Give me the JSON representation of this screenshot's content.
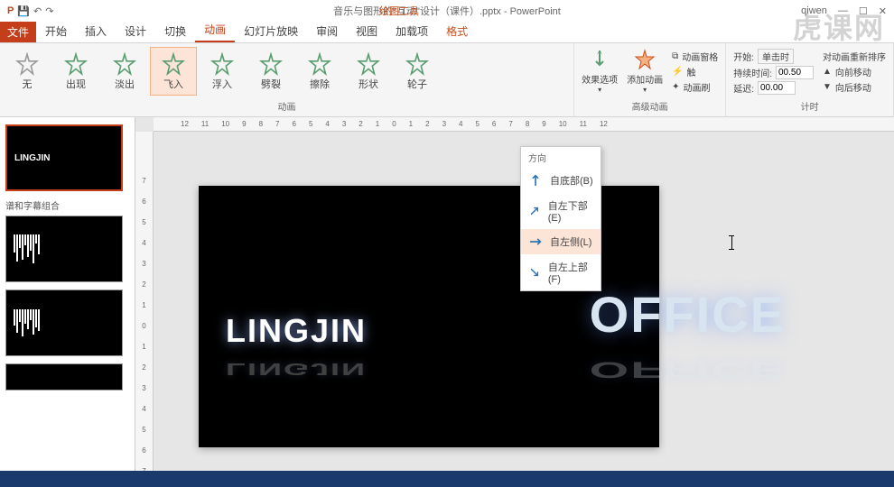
{
  "titlebar": {
    "title": "音乐与图形的\"互动\"设计（课件）.pptx - PowerPoint",
    "contextual": "绘图工具",
    "user": "qiwen"
  },
  "tabs": {
    "file": "文件",
    "items": [
      "开始",
      "插入",
      "设计",
      "切换",
      "动画",
      "幻灯片放映",
      "审阅",
      "视图",
      "加载项",
      "格式"
    ],
    "active_index": 4,
    "contextual_index": 9
  },
  "ribbon": {
    "animations": {
      "items": [
        {
          "label": "无",
          "color": "#999"
        },
        {
          "label": "出现",
          "color": "#5a9e6f"
        },
        {
          "label": "淡出",
          "color": "#5a9e6f"
        },
        {
          "label": "飞入",
          "color": "#5a9e6f"
        },
        {
          "label": "浮入",
          "color": "#5a9e6f"
        },
        {
          "label": "劈裂",
          "color": "#5a9e6f"
        },
        {
          "label": "擦除",
          "color": "#5a9e6f"
        },
        {
          "label": "形状",
          "color": "#5a9e6f"
        },
        {
          "label": "轮子",
          "color": "#5a9e6f"
        }
      ],
      "selected_index": 3,
      "group_label": "动画",
      "effect_options": "效果选项",
      "add_animation": "添加动画",
      "trigger": "触",
      "advanced_label": "高级动画",
      "pane": "动画窗格",
      "painter": "动画刷",
      "start_label": "开始:",
      "start_value": "单击时",
      "duration_label": "持续时间:",
      "duration_value": "00.50",
      "delay_label": "延迟:",
      "delay_value": "00.00",
      "reorder": "对动画重新排序",
      "move_earlier": "向前移动",
      "move_later": "向后移动",
      "timing_label": "计时"
    }
  },
  "dropdown": {
    "header": "方向",
    "items": [
      {
        "label": "自底部(B)",
        "dir": "up"
      },
      {
        "label": "自左下部(E)",
        "dir": "upright"
      },
      {
        "label": "自左侧(L)",
        "dir": "right"
      },
      {
        "label": "自左上部(F)",
        "dir": "downright"
      }
    ],
    "hover_index": 2
  },
  "slides": {
    "section_label": "谱和字幕组合",
    "thumb1_text": "LINGJIN"
  },
  "slide_content": {
    "text1": "LINGJIN",
    "text2": "OFFICE"
  },
  "ruler": {
    "h": [
      "12",
      "11",
      "10",
      "9",
      "8",
      "7",
      "6",
      "5",
      "4",
      "3",
      "2",
      "1",
      "0",
      "1",
      "2",
      "3",
      "4",
      "5",
      "6",
      "7",
      "8",
      "9",
      "10",
      "11",
      "12"
    ],
    "v": [
      "7",
      "6",
      "5",
      "4",
      "3",
      "2",
      "1",
      "0",
      "1",
      "2",
      "3",
      "4",
      "5",
      "6",
      "7"
    ]
  },
  "watermark": "虎课网"
}
